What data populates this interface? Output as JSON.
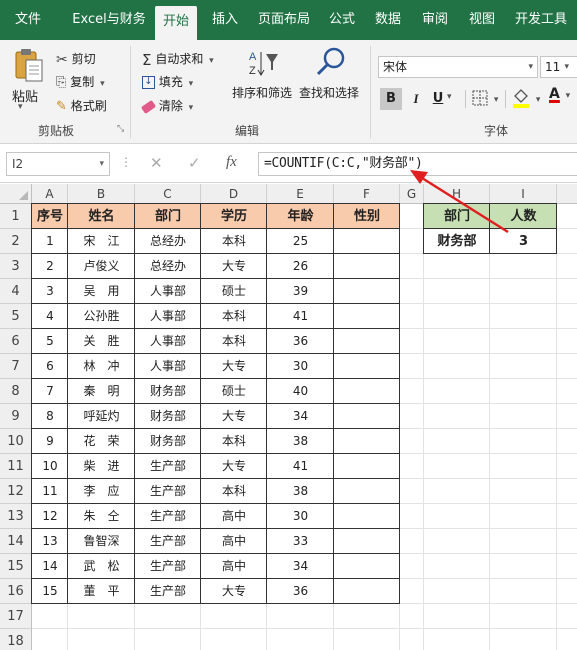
{
  "tabs": [
    "文件",
    "Excel与财务",
    "开始",
    "插入",
    "页面布局",
    "公式",
    "数据",
    "审阅",
    "视图",
    "开发工具"
  ],
  "active_tab": "开始",
  "clipboard": {
    "paste": "粘贴",
    "cut": "剪切",
    "copy": "复制",
    "format_painter": "格式刷",
    "label": "剪贴板"
  },
  "editing": {
    "autosum": "自动求和",
    "fill": "填充",
    "clear": "清除",
    "sort_filter": "排序和筛选",
    "find_select": "查找和选择",
    "label": "编辑"
  },
  "font": {
    "name": "宋体",
    "size": "11",
    "bold": "B",
    "italic": "I",
    "underline": "U",
    "font_color_letter": "A",
    "label": "字体",
    "font_color": "#e00000",
    "fill_color": "#ffff00"
  },
  "formula_bar": {
    "name_box": "I2",
    "fx": "fx",
    "formula": "=COUNTIF(C:C,\"财务部\")"
  },
  "columns": [
    "A",
    "B",
    "C",
    "D",
    "E",
    "F",
    "G",
    "H",
    "I"
  ],
  "rows": [
    "1",
    "2",
    "3",
    "4",
    "5",
    "6",
    "7",
    "8",
    "9",
    "10",
    "11",
    "12",
    "13",
    "14",
    "15",
    "16",
    "17",
    "18"
  ],
  "table": {
    "headers": [
      "序号",
      "姓名",
      "部门",
      "学历",
      "年龄",
      "性别"
    ],
    "data": [
      [
        "1",
        "宋　江",
        "总经办",
        "本科",
        "25",
        ""
      ],
      [
        "2",
        "卢俊义",
        "总经办",
        "大专",
        "26",
        ""
      ],
      [
        "3",
        "吴　用",
        "人事部",
        "硕士",
        "39",
        ""
      ],
      [
        "4",
        "公孙胜",
        "人事部",
        "本科",
        "41",
        ""
      ],
      [
        "5",
        "关　胜",
        "人事部",
        "本科",
        "36",
        ""
      ],
      [
        "6",
        "林　冲",
        "人事部",
        "大专",
        "30",
        ""
      ],
      [
        "7",
        "秦　明",
        "财务部",
        "硕士",
        "40",
        ""
      ],
      [
        "8",
        "呼延灼",
        "财务部",
        "大专",
        "34",
        ""
      ],
      [
        "9",
        "花　荣",
        "财务部",
        "本科",
        "38",
        ""
      ],
      [
        "10",
        "柴　进",
        "生产部",
        "大专",
        "41",
        ""
      ],
      [
        "11",
        "李　应",
        "生产部",
        "本科",
        "38",
        ""
      ],
      [
        "12",
        "朱　仝",
        "生产部",
        "高中",
        "30",
        ""
      ],
      [
        "13",
        "鲁智深",
        "生产部",
        "高中",
        "33",
        ""
      ],
      [
        "14",
        "武　松",
        "生产部",
        "高中",
        "34",
        ""
      ],
      [
        "15",
        "董　平",
        "生产部",
        "大专",
        "36",
        ""
      ]
    ]
  },
  "summary": {
    "header_dept": "部门",
    "header_count": "人数",
    "dept": "财务部",
    "count": "3"
  },
  "colors": {
    "ribbon_green": "#217346",
    "header_orange": "#f8cbad",
    "header_green": "#c6e0b4",
    "annotation_arrow": "#e02020"
  }
}
